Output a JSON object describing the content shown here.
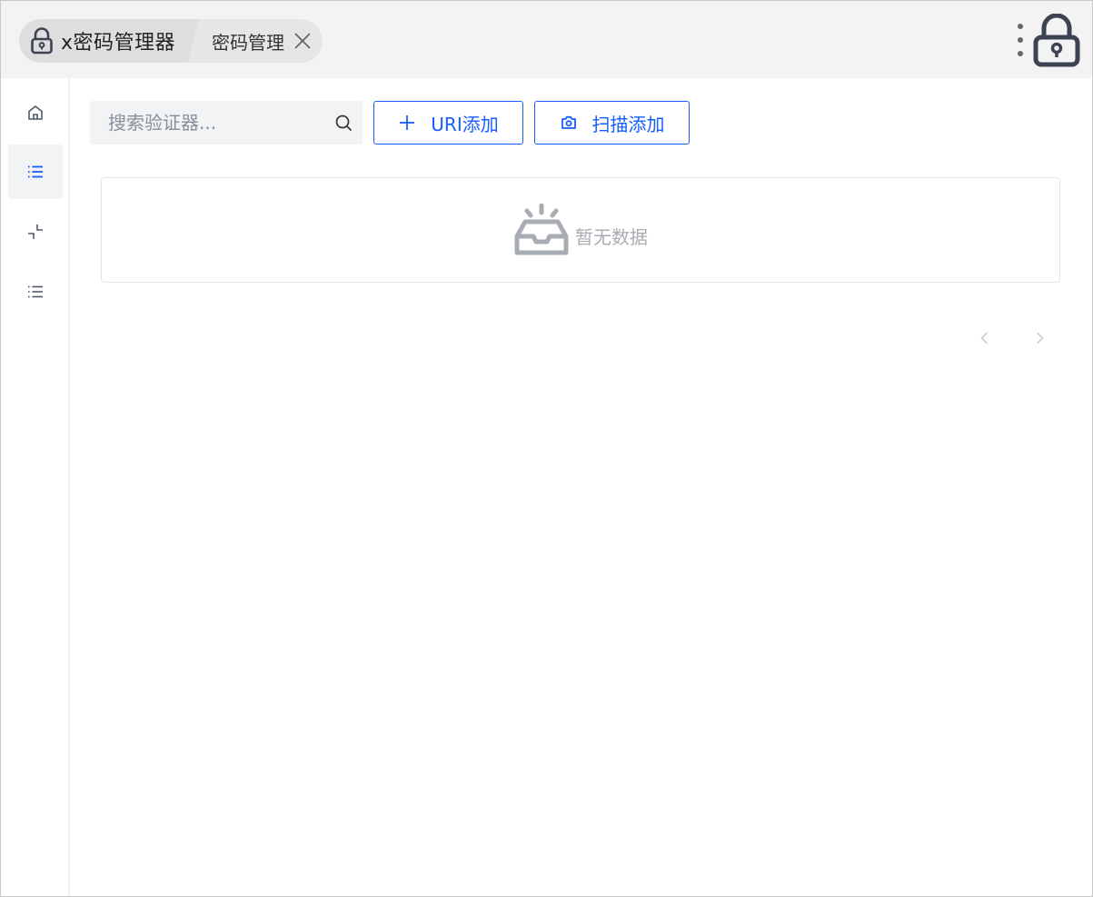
{
  "header": {
    "app_title": "x密码管理器",
    "tab_label": "密码管理",
    "icons": {
      "app": "lock-icon",
      "close": "close-icon",
      "menu": "more-vertical-icon",
      "lock": "lock-icon"
    }
  },
  "sidebar": {
    "items": [
      {
        "icon": "home-icon",
        "active": false
      },
      {
        "icon": "list-icon",
        "active": true
      },
      {
        "icon": "shrink-icon",
        "active": false
      },
      {
        "icon": "list-icon",
        "active": false
      }
    ]
  },
  "toolbar": {
    "search_placeholder": "搜索验证器...",
    "search_value": "",
    "uri_add_label": "URI添加",
    "scan_add_label": "扫描添加"
  },
  "empty": {
    "text": "暂无数据",
    "icon": "empty-inbox-icon"
  },
  "pagination": {
    "prev_icon": "chevron-left-icon",
    "next_icon": "chevron-right-icon"
  },
  "colors": {
    "primary": "#165dff",
    "header_bg": "#f3f3f3",
    "crumb_bg": "#dedede",
    "sidebar_active_bg": "#f2f3f5",
    "muted_text": "#a8acb3",
    "icon_dark": "#3d4252"
  }
}
